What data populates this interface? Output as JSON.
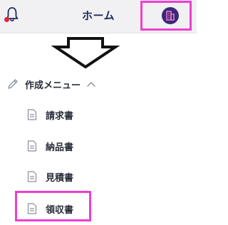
{
  "header": {
    "title": "ホーム",
    "notification_dot_color": "#e5233a",
    "accent_color": "#1f2a5c",
    "avatar_color": "#3a2a78",
    "highlight_color": "#ee3fd0"
  },
  "menu": {
    "label": "作成メニュー",
    "state": "expanded",
    "items": [
      {
        "label": "請求書",
        "icon": "document-icon"
      },
      {
        "label": "納品書",
        "icon": "document-icon"
      },
      {
        "label": "見積書",
        "icon": "document-icon"
      },
      {
        "label": "領収書",
        "icon": "document-icon"
      }
    ]
  },
  "icons": {
    "bell": "bell-icon",
    "menu_header": "pencil-icon",
    "chevron": "chevron-up-icon",
    "arrow": "down-arrow-icon"
  }
}
